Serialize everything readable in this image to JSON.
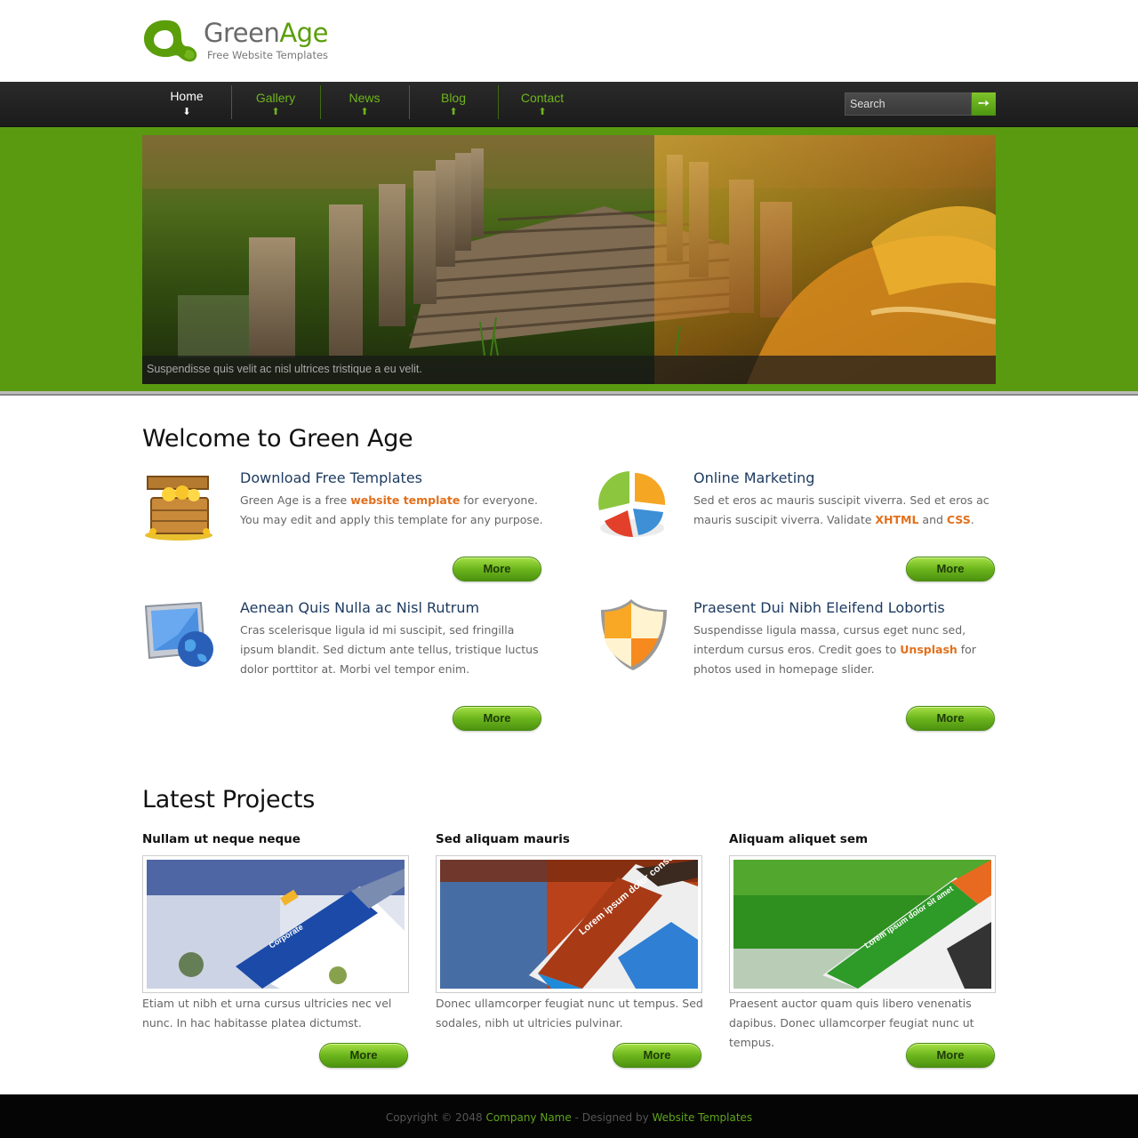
{
  "brand": {
    "name_part1": "Green",
    "name_part2": "Age",
    "tagline": "Free Website Templates",
    "accent_color": "#5a9e0a"
  },
  "nav": {
    "items": [
      {
        "label": "Home",
        "arrow": "⬇",
        "active": true
      },
      {
        "label": "Gallery",
        "arrow": "⬆",
        "active": false
      },
      {
        "label": "News",
        "arrow": "⬆",
        "active": false
      },
      {
        "label": "Blog",
        "arrow": "⬆",
        "active": false
      },
      {
        "label": "Contact",
        "arrow": "⬆",
        "active": false
      }
    ],
    "search_placeholder": "Search",
    "search_button_icon": "➙"
  },
  "banner": {
    "caption": "Suspendisse quis velit ac nisl ultrices tristique a eu velit."
  },
  "welcome": {
    "title": "Welcome to Green Age",
    "features": [
      {
        "icon": "treasure-chest-icon",
        "title": "Download Free Templates",
        "text_before": "Green Age is a free ",
        "highlight": "website template",
        "text_after": " for everyone. You may edit and apply this template for any purpose.",
        "button": "More"
      },
      {
        "icon": "pie-chart-icon",
        "title": "Online Marketing",
        "text_before": "Sed et eros ac mauris suscipit viverra. Sed et eros ac mauris suscipit viverra. Validate ",
        "highlight": "XHTML",
        "text_middle": " and ",
        "highlight2": "CSS",
        "text_after": ".",
        "button": "More"
      },
      {
        "icon": "monitor-globe-icon",
        "title": "Aenean Quis Nulla ac Nisl Rutrum",
        "text_before": "Cras scelerisque ligula id mi suscipit, sed fringilla ipsum blandit. Sed dictum ante tellus, tristique luctus dolor porttitor at. Morbi vel tempor enim.",
        "button": "More"
      },
      {
        "icon": "shield-icon",
        "title": "Praesent Dui Nibh Eleifend Lobortis",
        "text_before": "Suspendisse ligula massa, cursus eget nunc sed, interdum cursus eros. Credit goes to ",
        "highlight": "Unsplash",
        "text_after": " for photos used in homepage slider.",
        "button": "More"
      }
    ]
  },
  "projects": {
    "title": "Latest Projects",
    "items": [
      {
        "title": "Nullam ut neque neque",
        "text": "Etiam ut nibh et urna cursus ultricies nec vel nunc. In hac habitasse platea dictumst.",
        "button": "More",
        "thumb_label": "Corporate"
      },
      {
        "title": "Sed aliquam mauris",
        "text": "Donec ullamcorper feugiat nunc ut tempus. Sed sodales, nibh ut ultricies pulvinar.",
        "button": "More",
        "thumb_label": "Lorem ipsum dolor consectetur adipiscing"
      },
      {
        "title": "Aliquam aliquet sem",
        "text": "Praesent auctor quam quis libero venenatis dapibus. Donec ullamcorper feugiat nunc ut tempus.",
        "button": "More",
        "thumb_label": "Lorem ipsum dolor sit amet"
      }
    ]
  },
  "footer": {
    "prefix": "Copyright © 2048 ",
    "company": "Company Name",
    "middle": " - Designed by ",
    "designer": "Website Templates"
  }
}
